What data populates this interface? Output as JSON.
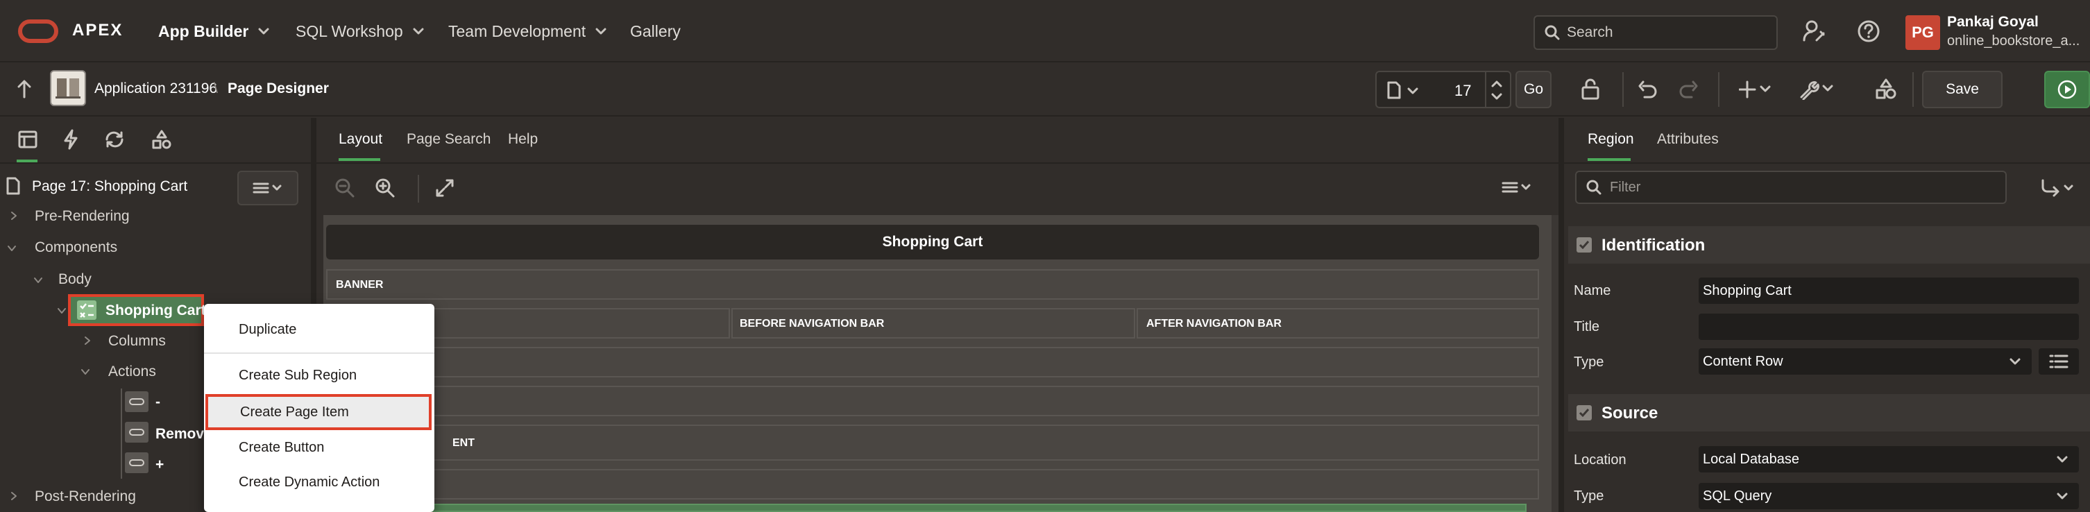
{
  "topbar": {
    "brand": "APEX",
    "nav": [
      "App Builder",
      "SQL Workshop",
      "Team Development",
      "Gallery"
    ],
    "search_placeholder": "Search",
    "user_initials": "PG",
    "user_name": "Pankaj Goyal",
    "user_app": "online_bookstore_a..."
  },
  "toolbar": {
    "app_label": "Application 231196",
    "separator": "\\",
    "page_designer": "Page Designer",
    "page_number": "17",
    "go_label": "Go",
    "save_label": "Save"
  },
  "left": {
    "page_title": "Page 17: Shopping Cart",
    "tree": {
      "pre_rendering": "Pre-Rendering",
      "components": "Components",
      "body": "Body",
      "shopping_cart": "Shopping Cart",
      "columns": "Columns",
      "actions": "Actions",
      "item_minus": "-",
      "item_remove": "Remove",
      "item_plus": "+",
      "post_rendering": "Post-Rendering"
    }
  },
  "context_menu": {
    "items": [
      "Duplicate",
      "Create Sub Region",
      "Create Page Item",
      "Create Button",
      "Create Dynamic Action"
    ],
    "highlighted_index": 2
  },
  "center": {
    "tabs": [
      "Layout",
      "Page Search",
      "Help"
    ],
    "active_tab": "Layout",
    "page_header": "Shopping Cart",
    "banner": "BANNER",
    "before_nav": "BEFORE NAVIGATION BAR",
    "after_nav": "AFTER NAVIGATION BAR",
    "content_fragment": "ENT"
  },
  "right": {
    "tabs": [
      "Region",
      "Attributes"
    ],
    "active_tab": "Region",
    "filter_placeholder": "Filter",
    "identification": {
      "title": "Identification",
      "name_label": "Name",
      "name_value": "Shopping Cart",
      "title_label": "Title",
      "title_value": "",
      "type_label": "Type",
      "type_value": "Content Row"
    },
    "source": {
      "title": "Source",
      "location_label": "Location",
      "location_value": "Local Database",
      "type_label": "Type",
      "type_value": "SQL Query"
    }
  },
  "colors": {
    "background": "#312d2a",
    "accent_red": "#c74634",
    "highlight_red": "#e0402a",
    "tree_selected": "#4f7d52",
    "run_green": "#3d7a44"
  }
}
